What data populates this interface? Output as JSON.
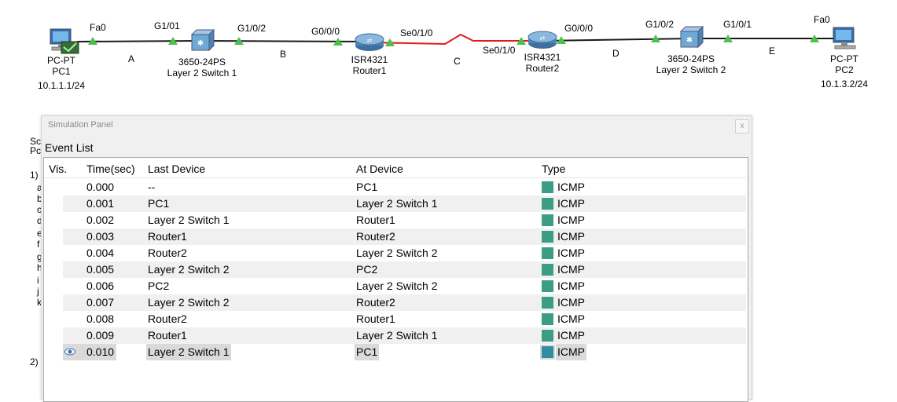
{
  "colors": {
    "link": "#1a1a1a",
    "serial_link": "#e41a1a",
    "port_triangle": "#4cbf4c",
    "alt_row": "#f0f0f0",
    "highlight": "#dadada",
    "icmp": "#3c9c84",
    "icmp_last": "#2f8fa0"
  },
  "topology": {
    "ports": [
      "Fa0",
      "G1/01",
      "G1/0/2",
      "G0/0/0",
      "Se0/1/0",
      "Se0/1/0",
      "G0/0/0",
      "G1/0/2",
      "G1/0/1",
      "Fa0"
    ],
    "links": [
      "A",
      "B",
      "C",
      "D",
      "E"
    ],
    "pc1": {
      "type": "PC-PT",
      "name": "PC1",
      "ip": "10.1.1.1/24"
    },
    "switch1": {
      "model": "3650-24PS",
      "name": "Layer 2 Switch 1"
    },
    "router1": {
      "model": "ISR4321",
      "name": "Router1"
    },
    "router2": {
      "model": "ISR4321",
      "name": "Router2"
    },
    "switch2": {
      "model": "3650-24PS",
      "name": "Layer 2 Switch 2"
    },
    "pc2": {
      "type": "PC-PT",
      "name": "PC2",
      "ip": "10.1.3.2/24"
    }
  },
  "background_text": [
    "Sc",
    "Pc",
    "1)",
    "a",
    "b",
    "c",
    "d",
    "e",
    "f",
    "g",
    "h",
    "i",
    "j",
    "k",
    "2)"
  ],
  "simulation_panel": {
    "title": "Simulation Panel",
    "close": "x",
    "section": "Event List",
    "columns": [
      "Vis.",
      "Time(sec)",
      "Last Device",
      "At Device",
      "Type"
    ],
    "events": [
      {
        "time": "0.000",
        "last": "--",
        "at": "PC1",
        "type": "ICMP"
      },
      {
        "time": "0.001",
        "last": "PC1",
        "at": "Layer 2 Switch 1",
        "type": "ICMP"
      },
      {
        "time": "0.002",
        "last": "Layer 2 Switch 1",
        "at": "Router1",
        "type": "ICMP"
      },
      {
        "time": "0.003",
        "last": "Router1",
        "at": "Router2",
        "type": "ICMP"
      },
      {
        "time": "0.004",
        "last": "Router2",
        "at": "Layer 2 Switch 2",
        "type": "ICMP"
      },
      {
        "time": "0.005",
        "last": "Layer 2 Switch 2",
        "at": "PC2",
        "type": "ICMP"
      },
      {
        "time": "0.006",
        "last": "PC2",
        "at": "Layer 2 Switch 2",
        "type": "ICMP"
      },
      {
        "time": "0.007",
        "last": "Layer 2 Switch 2",
        "at": "Router2",
        "type": "ICMP"
      },
      {
        "time": "0.008",
        "last": "Router2",
        "at": "Router1",
        "type": "ICMP"
      },
      {
        "time": "0.009",
        "last": "Router1",
        "at": "Layer 2 Switch 1",
        "type": "ICMP"
      },
      {
        "time": "0.010",
        "last": "Layer 2 Switch 1",
        "at": "PC1",
        "type": "ICMP"
      }
    ]
  }
}
